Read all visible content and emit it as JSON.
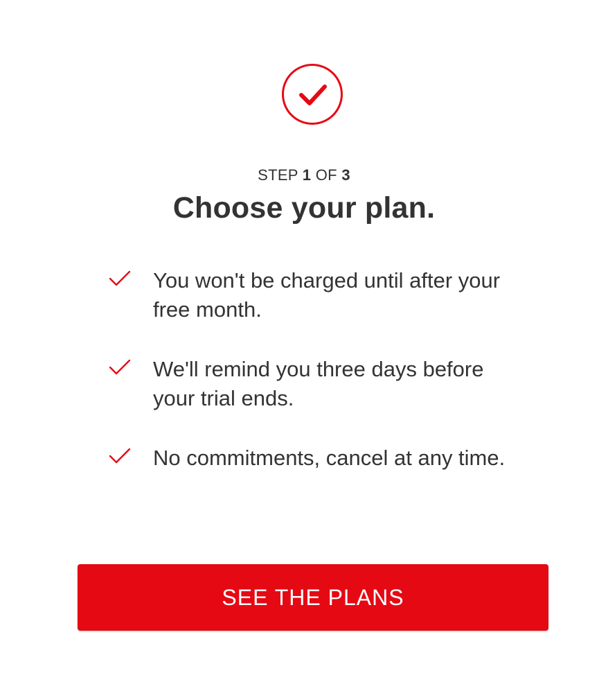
{
  "icons": {
    "header": "check-circle-icon",
    "benefit": "checkmark-icon"
  },
  "colors": {
    "accent": "#e50914",
    "text": "#333333",
    "background": "#ffffff"
  },
  "step": {
    "prefix": "STEP",
    "current": "1",
    "separator": "OF",
    "total": "3"
  },
  "title": "Choose your plan.",
  "benefits": [
    {
      "text": "You won't be charged until after your free month."
    },
    {
      "text": "We'll remind you three days before your trial ends."
    },
    {
      "text": "No commitments, cancel at any time."
    }
  ],
  "cta": {
    "label": "SEE THE PLANS"
  }
}
